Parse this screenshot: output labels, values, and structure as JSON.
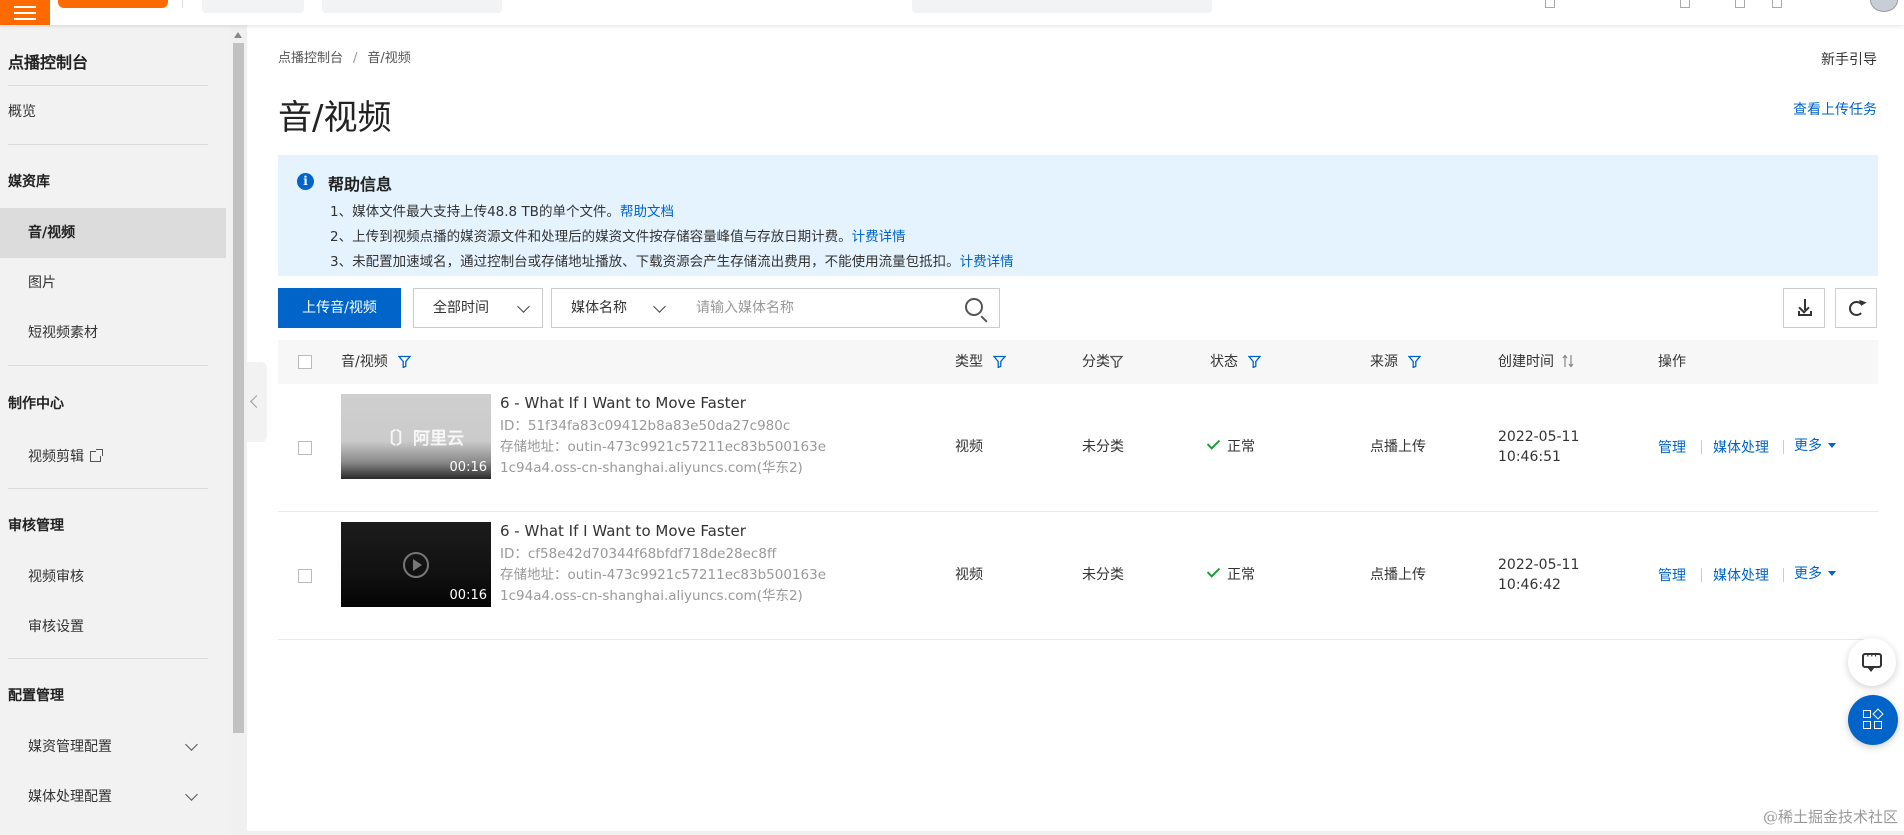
{
  "topbar": {
    "brand_color": "#ff6a00"
  },
  "sidebar": {
    "title": "点播控制台",
    "overview": "概览",
    "sections": [
      {
        "label": "媒资库",
        "items": [
          "音/视频",
          "图片",
          "短视频素材"
        ]
      },
      {
        "label": "制作中心",
        "items": [
          "视频剪辑"
        ]
      },
      {
        "label": "审核管理",
        "items": [
          "视频审核",
          "审核设置"
        ]
      },
      {
        "label": "配置管理",
        "items": [
          "媒资管理配置",
          "媒体处理配置"
        ]
      }
    ],
    "active_item": "音/视频"
  },
  "breadcrumb": {
    "root": "点播控制台",
    "current": "音/视频"
  },
  "header": {
    "guide": "新手引导",
    "title": "音/视频",
    "upload_tasks": "查看上传任务"
  },
  "help": {
    "title": "帮助信息",
    "lines": [
      {
        "text": "1、媒体文件最大支持上传48.8 TB的单个文件。",
        "link": "帮助文档"
      },
      {
        "text": "2、上传到视频点播的媒资源文件和处理后的媒资文件按存储容量峰值与存放日期计费。",
        "link": "计费详情"
      },
      {
        "text": "3、未配置加速域名，通过控制台或存储地址播放、下载资源会产生存储流出费用，不能使用流量包抵扣。",
        "link": "计费详情"
      }
    ]
  },
  "toolbar": {
    "upload_button": "上传音/视频",
    "time_select": "全部时间",
    "field_select": "媒体名称",
    "search_placeholder": "请输入媒体名称"
  },
  "table": {
    "columns": {
      "media": "音/视频",
      "type": "类型",
      "category": "分类",
      "status": "状态",
      "source": "来源",
      "created": "创建时间",
      "actions": "操作"
    },
    "rows": [
      {
        "title": "6 - What If I Want to Move Faster",
        "id": "ID：51f34fa83c09412b8a83e50da27c980c",
        "storage": "存储地址：outin-473c9921c57211ec83b500163e1c94a4.oss-cn-shanghai.aliyuncs.com(华东2)",
        "duration": "00:16",
        "thumb_watermark": "〔〕阿里云",
        "type": "视频",
        "category": "未分类",
        "status": "正常",
        "source": "点播上传",
        "created_date": "2022-05-11",
        "created_time": "10:46:51",
        "actions": [
          "管理",
          "媒体处理",
          "更多"
        ]
      },
      {
        "title": "6 - What If I Want to Move Faster",
        "id": "ID：cf58e42d70344f68bfdf718de28ec8ff",
        "storage": "存储地址：outin-473c9921c57211ec83b500163e1c94a4.oss-cn-shanghai.aliyuncs.com(华东2)",
        "duration": "00:16",
        "type": "视频",
        "category": "未分类",
        "status": "正常",
        "source": "点播上传",
        "created_date": "2022-05-11",
        "created_time": "10:46:42",
        "actions": [
          "管理",
          "媒体处理",
          "更多"
        ]
      }
    ]
  },
  "watermark": "@稀土掘金技术社区",
  "colors": {
    "accent": "#0064c8",
    "help_bg": "#e5f3ff",
    "status_ok": "#1e9e3d"
  }
}
